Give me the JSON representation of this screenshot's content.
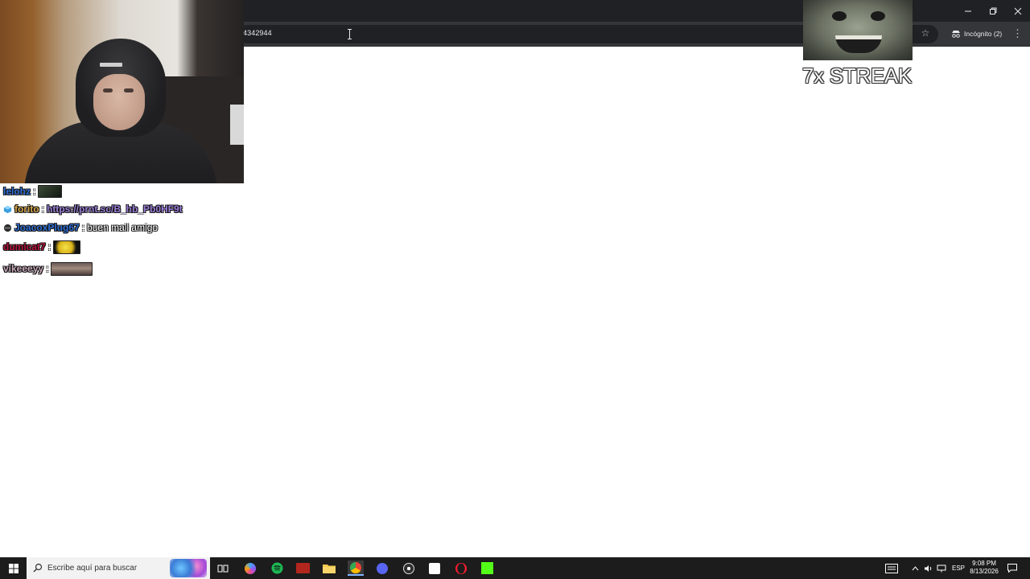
{
  "browser": {
    "url_text": "4342944",
    "incognito_label": "Incógnito (2)"
  },
  "streak": {
    "label": "7x STREAK"
  },
  "chat": {
    "messages": [
      {
        "user": "lelohz",
        "sep": ":",
        "text": "",
        "user_color": "#2f6fd6"
      },
      {
        "user": "forito",
        "sep": ":",
        "text": "https://prnt.sc/B_hb_Pb0HF9t",
        "user_color": "#d8a84a",
        "text_kind": "link"
      },
      {
        "user": "JoacoxPlug67",
        "sep": ":",
        "text": "buen mail amigo",
        "user_color": "#2f6fd6"
      },
      {
        "user": "dumicat7",
        "sep": ":",
        "text": "",
        "user_color": "#b3123c"
      },
      {
        "user": "vikeeeyy",
        "sep": ":",
        "text": "",
        "user_color": "#c7a9b8"
      }
    ]
  },
  "taskbar": {
    "search_placeholder": "Escribe aquí para buscar",
    "language": "ESP",
    "time": "9:08 PM",
    "date": "8/13/2026"
  },
  "colors": {
    "titlebar": "#202124",
    "toolbar": "#35363a",
    "taskbar": "#1c1c1c",
    "link": "#9b7ed8"
  }
}
